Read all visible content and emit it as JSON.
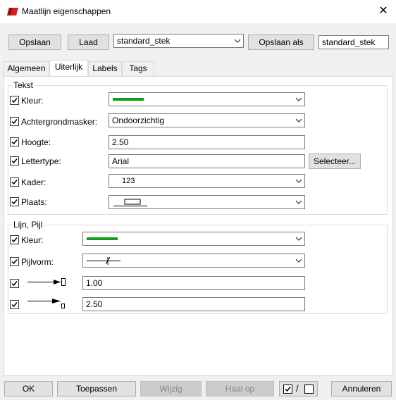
{
  "window": {
    "title": "Maatlijn eigenschappen"
  },
  "toolbar": {
    "save_label": "Opslaan",
    "load_label": "Laad",
    "style_select_value": "standard_stek",
    "save_as_label": "Opslaan als",
    "save_as_value": "standard_stek"
  },
  "tabs": [
    {
      "label": "Algemeen"
    },
    {
      "label": "Uiterlijk",
      "active": true
    },
    {
      "label": "Labels"
    },
    {
      "label": "Tags"
    }
  ],
  "text_group": {
    "title": "Tekst",
    "color_label": "Kleur:",
    "color_value": "#1a9a1a",
    "bgmask_label": "Achtergrondmasker:",
    "bgmask_value": "Ondoorzichtig",
    "height_label": "Hoogte:",
    "height_value": "2.50",
    "font_label": "Lettertype:",
    "font_value": "Arial",
    "font_select_label": "Selecteer...",
    "frame_label": "Kader:",
    "frame_value": "123",
    "place_label": "Plaats:"
  },
  "line_group": {
    "title": "Lijn, Pijl",
    "color_label": "Kleur:",
    "color_value": "#1a9a1a",
    "arrow_label": "Pijlvorm:",
    "arrow_size1_value": "1.00",
    "arrow_size2_value": "2.50"
  },
  "footer": {
    "ok_label": "OK",
    "apply_label": "Toepassen",
    "change_label": "Wijzig",
    "fetch_label": "Haal op",
    "toggle_label": "/",
    "cancel_label": "Annuleren"
  }
}
